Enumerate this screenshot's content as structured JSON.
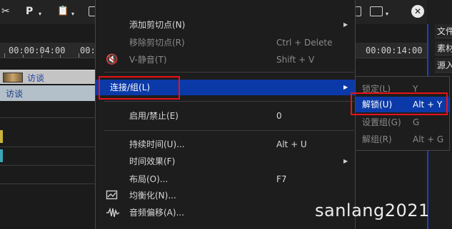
{
  "toolbar": {
    "cut_glyph": "✂",
    "p_label": "P",
    "dropdown_glyph": "▾",
    "clipboard_glyph": "📋",
    "close_glyph": "✕"
  },
  "timeline": {
    "ruler_left": "00:00:04:00",
    "ruler_mid": "00:00",
    "ruler_right": "00:00:14:00",
    "clip_top": "访谈",
    "clip_bottom": "访谈"
  },
  "right_panel": {
    "tabs": [
      "文件",
      "素材",
      "源入"
    ]
  },
  "menu": {
    "items": [
      {
        "label": "添加剪切点(N)",
        "shortcut": "",
        "has_submenu": true,
        "disabled": false
      },
      {
        "label": "移除剪切点(R)",
        "shortcut": "Ctrl + Delete",
        "has_submenu": false,
        "disabled": true
      },
      {
        "label": "V-静音(T)",
        "shortcut": "Shift + V",
        "has_submenu": false,
        "disabled": true
      },
      {
        "label": "连接/组(L)",
        "shortcut": "",
        "has_submenu": true,
        "disabled": false,
        "active": true
      },
      {
        "label": "启用/禁止(E)",
        "shortcut": "0",
        "has_submenu": false,
        "disabled": false
      },
      {
        "label": "持续时间(U)...",
        "shortcut": "Alt + U",
        "has_submenu": false,
        "disabled": false
      },
      {
        "label": "时间效果(F)",
        "shortcut": "",
        "has_submenu": true,
        "disabled": false
      },
      {
        "label": "布局(O)...",
        "shortcut": "F7",
        "has_submenu": false,
        "disabled": false
      },
      {
        "label": "均衡化(N)...",
        "shortcut": "",
        "has_submenu": false,
        "disabled": false
      },
      {
        "label": "音频偏移(A)...",
        "shortcut": "",
        "has_submenu": false,
        "disabled": false
      }
    ],
    "arrow_glyph": "▶"
  },
  "submenu": {
    "items": [
      {
        "label": "锁定(L)",
        "shortcut": "Y",
        "disabled": true
      },
      {
        "label": "解锁(U)",
        "shortcut": "Alt + Y",
        "disabled": false,
        "active": true
      },
      {
        "label": "设置组(G)",
        "shortcut": "G",
        "disabled": true
      },
      {
        "label": "解组(R)",
        "shortcut": "Alt + G",
        "disabled": true
      }
    ]
  },
  "watermark": "sanlang2021",
  "colors": {
    "menu_bg": "#1d1d1d",
    "highlight": "#0b3aa8",
    "callout": "#e8121b",
    "disabled_text": "#8a8a8a"
  }
}
